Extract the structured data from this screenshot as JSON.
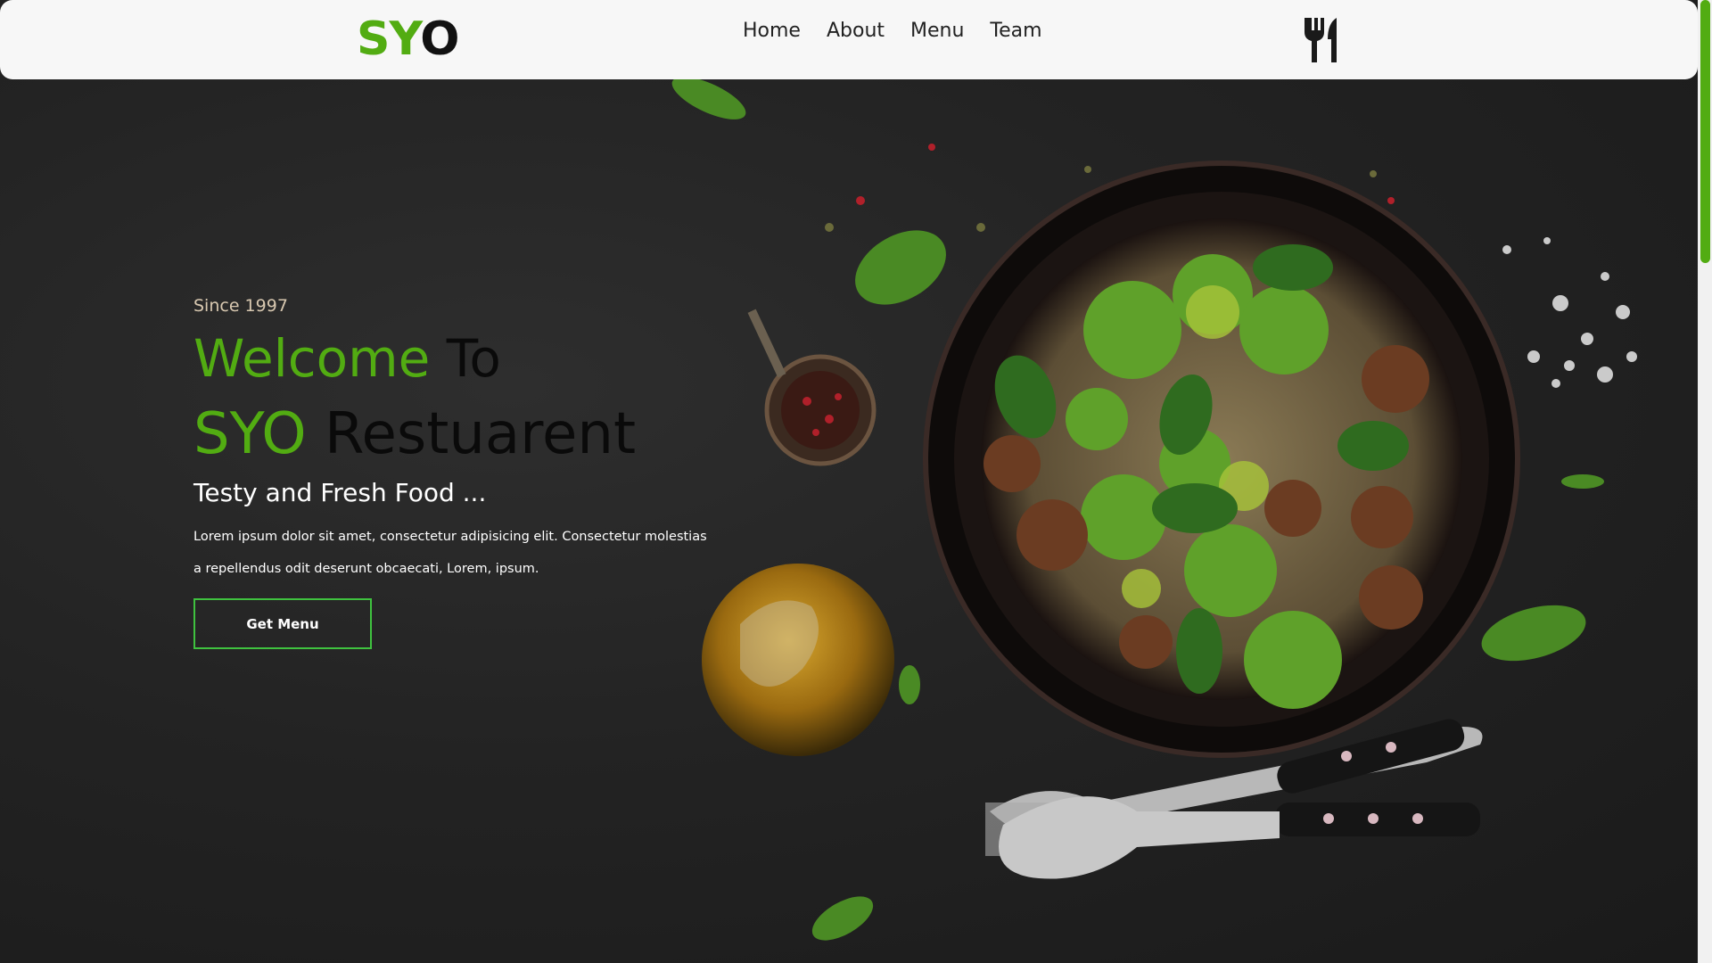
{
  "navbar": {
    "logo_green": "SY",
    "logo_dark": "O",
    "links": [
      "Home",
      "About",
      "Menu",
      "Team"
    ]
  },
  "hero": {
    "since": "Since 1997",
    "title_line1_green": "Welcome",
    "title_line1_dark": "To",
    "title_line2_green": "SYO",
    "title_line2_dark": "Restuarent",
    "tagline": "Testy and Fresh Food ...",
    "description": "Lorem ipsum dolor sit amet, consectetur adipisicing elit. Consectetur molestias a repellendus odit deserunt obcaecati, Lorem, ipsum.",
    "button_label": "Get Menu"
  },
  "icons": {
    "utensils": "utensils-icon"
  },
  "colors": {
    "accent": "#52ac12",
    "button_border": "#3fc23f",
    "background": "#232323"
  }
}
